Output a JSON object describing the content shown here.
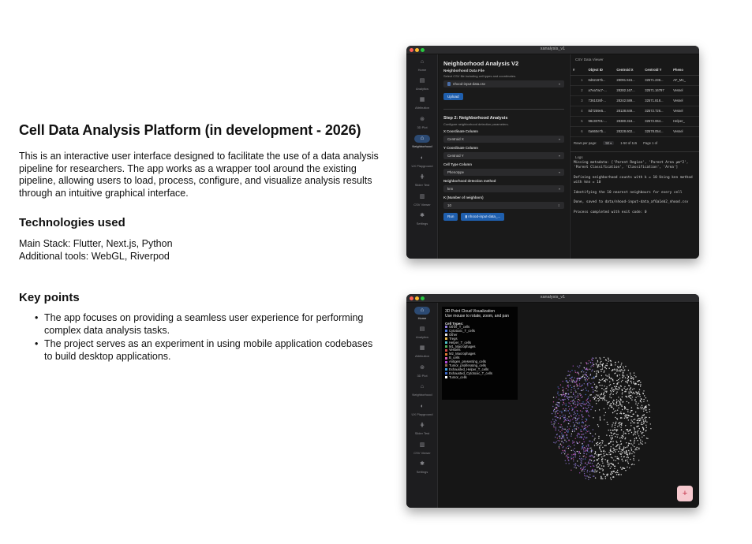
{
  "page": {
    "title": "Cell Data Analysis Platform (in development - 2026)",
    "intro": "This is an interactive user interface designed to facilitate the use of a data analysis pipeline for researchers.  The app works as a wrapper tool around the existing pipeline, allowing users to load, process, configure, and visualize analysis results through an intuitive graphical interface.",
    "tech_heading": "Technologies used",
    "main_stack": "Main Stack: Flutter, Next.js, Python",
    "additional_tools": "Additional tools: WebGL, Riverpod",
    "key_heading": "Key points",
    "key_points": [
      "The app focuses on providing a seamless user experience for performing complex data analysis tasks.",
      "The project serves as an experiment in using mobile application codebases to build desktop applications."
    ],
    "bullet": "•"
  },
  "window_title": "xanalysis_v1",
  "nav": [
    {
      "label": "Home",
      "icon": "home-icon",
      "glyph": "⌂"
    },
    {
      "label": "Analytics",
      "icon": "analytics-icon",
      "glyph": "▤"
    },
    {
      "label": "Attribution",
      "icon": "attribution-icon",
      "glyph": "▦"
    },
    {
      "label": "3D Plot",
      "icon": "plot-3d-icon",
      "glyph": "⊛"
    },
    {
      "label": "Neighborhood",
      "icon": "neighborhood-icon",
      "glyph": "⌂"
    },
    {
      "label": "UX Playground",
      "icon": "palette-icon",
      "glyph": "◐"
    },
    {
      "label": "Slider Test",
      "icon": "slider-icon",
      "glyph": "⋕"
    },
    {
      "label": "CSV Viewer",
      "icon": "csv-icon",
      "glyph": "▥"
    },
    {
      "label": "Settings",
      "icon": "gear-icon",
      "glyph": "✱"
    }
  ],
  "neighborhood": {
    "title": "Neighborhood Analysis V2",
    "file_section": "Neighborhood Data File",
    "file_hint": "Select CSV file including cell types and coordinates.",
    "file_value": "nhood-input-data.csv",
    "upload_label": "Upload",
    "step2_title": "Step 2: Neighborhood Analysis",
    "step2_hint": "Configure neighborhood detection parameters.",
    "fields": [
      {
        "label": "X Coordinate Column",
        "value": "Centroid X"
      },
      {
        "label": "Y Coordinate Column",
        "value": "Centroid Y"
      },
      {
        "label": "Cell Type Column",
        "value": "Phenotype"
      },
      {
        "label": "Neighborhood detection method",
        "value": "knn"
      },
      {
        "label": "K (Number of neighbors)",
        "value": "10"
      }
    ],
    "run_label": "Run",
    "file_button": "nhood-input-data_..."
  },
  "csv_viewer": {
    "title": "CSV Data Viewer",
    "columns": [
      "#",
      "Object ID",
      "Centroid X",
      "Centroid Y",
      "Pheno"
    ],
    "rows": [
      [
        "1",
        "6d62c67b...",
        "28091.515...",
        "32571.236...",
        "AF_M1_"
      ],
      [
        "2",
        "a7ea7ac7-...",
        "28282.167...",
        "32571.16797",
        "Vessel"
      ],
      [
        "3",
        "7361026f-...",
        "28242.589...",
        "32571.818...",
        "Vessel"
      ],
      [
        "4",
        "8d7259e5...",
        "28138.849...",
        "32572.726...",
        "Vessel"
      ],
      [
        "5",
        "98c30701-...",
        "28380.318...",
        "32572.064...",
        "Helper_"
      ],
      [
        "6",
        "0a660e7b...",
        "28228.602...",
        "32578.054...",
        "Vessel"
      ]
    ],
    "rows_per_page_label": "Rows per page:",
    "rows_per_page": "50",
    "range": "1-50 of 115",
    "page": "Page 1 of"
  },
  "logs": {
    "title": "Logs",
    "lines": [
      "Missing metadata: ['Parent Region', 'Parent Area µm^2', 'Parent Classification', 'Classification', 'Area']",
      "Defining neighborhood counts with k = 10 Using knn method with knn = 10",
      "Identifying the 10 nearest neighbours for every cell",
      "Done, saved to data/nhood-input-data_af6a1eb2_nhood.csv",
      "Process completed with exit code: 0"
    ]
  },
  "point_cloud": {
    "title": "3D Point Cloud Visualization",
    "subtitle": "Use mouse to rotate, zoom, and pan",
    "legend_title": "Cell Types:",
    "cell_types": [
      {
        "name": "Other_T_cells",
        "color": "#8f7bd8"
      },
      {
        "name": "Cytotoxic_T_cells",
        "color": "#4f7de0"
      },
      {
        "name": "Other",
        "color": "#e8e8e8"
      },
      {
        "name": "Tregs",
        "color": "#e6b84a"
      },
      {
        "name": "Helper_T_cells",
        "color": "#4ec0c6"
      },
      {
        "name": "M1_Macrophages",
        "color": "#58b05b"
      },
      {
        "name": "Vessels",
        "color": "#d04a4a"
      },
      {
        "name": "M2_Macrophages",
        "color": "#e07b2e"
      },
      {
        "name": "B_cells",
        "color": "#d65db1"
      },
      {
        "name": "Antigen_presenting_cells",
        "color": "#b04dd6"
      },
      {
        "name": "Tumor_proliferating_cells",
        "color": "#8b6a4a"
      },
      {
        "name": "Exhausted_Helper_T_cells",
        "color": "#3fa0e0"
      },
      {
        "name": "Exhausted_Cytotoxic_T_cells",
        "color": "#3b67c9"
      },
      {
        "name": "Tumor_cells",
        "color": "#ffffff"
      }
    ],
    "fab_glyph": "+"
  },
  "colors": {
    "accent": "#1f5fae",
    "rail_active": "#2c4a73",
    "window_bg": "#161616",
    "fab_bg": "#f6c9cf",
    "fab_fg": "#c3334a"
  }
}
